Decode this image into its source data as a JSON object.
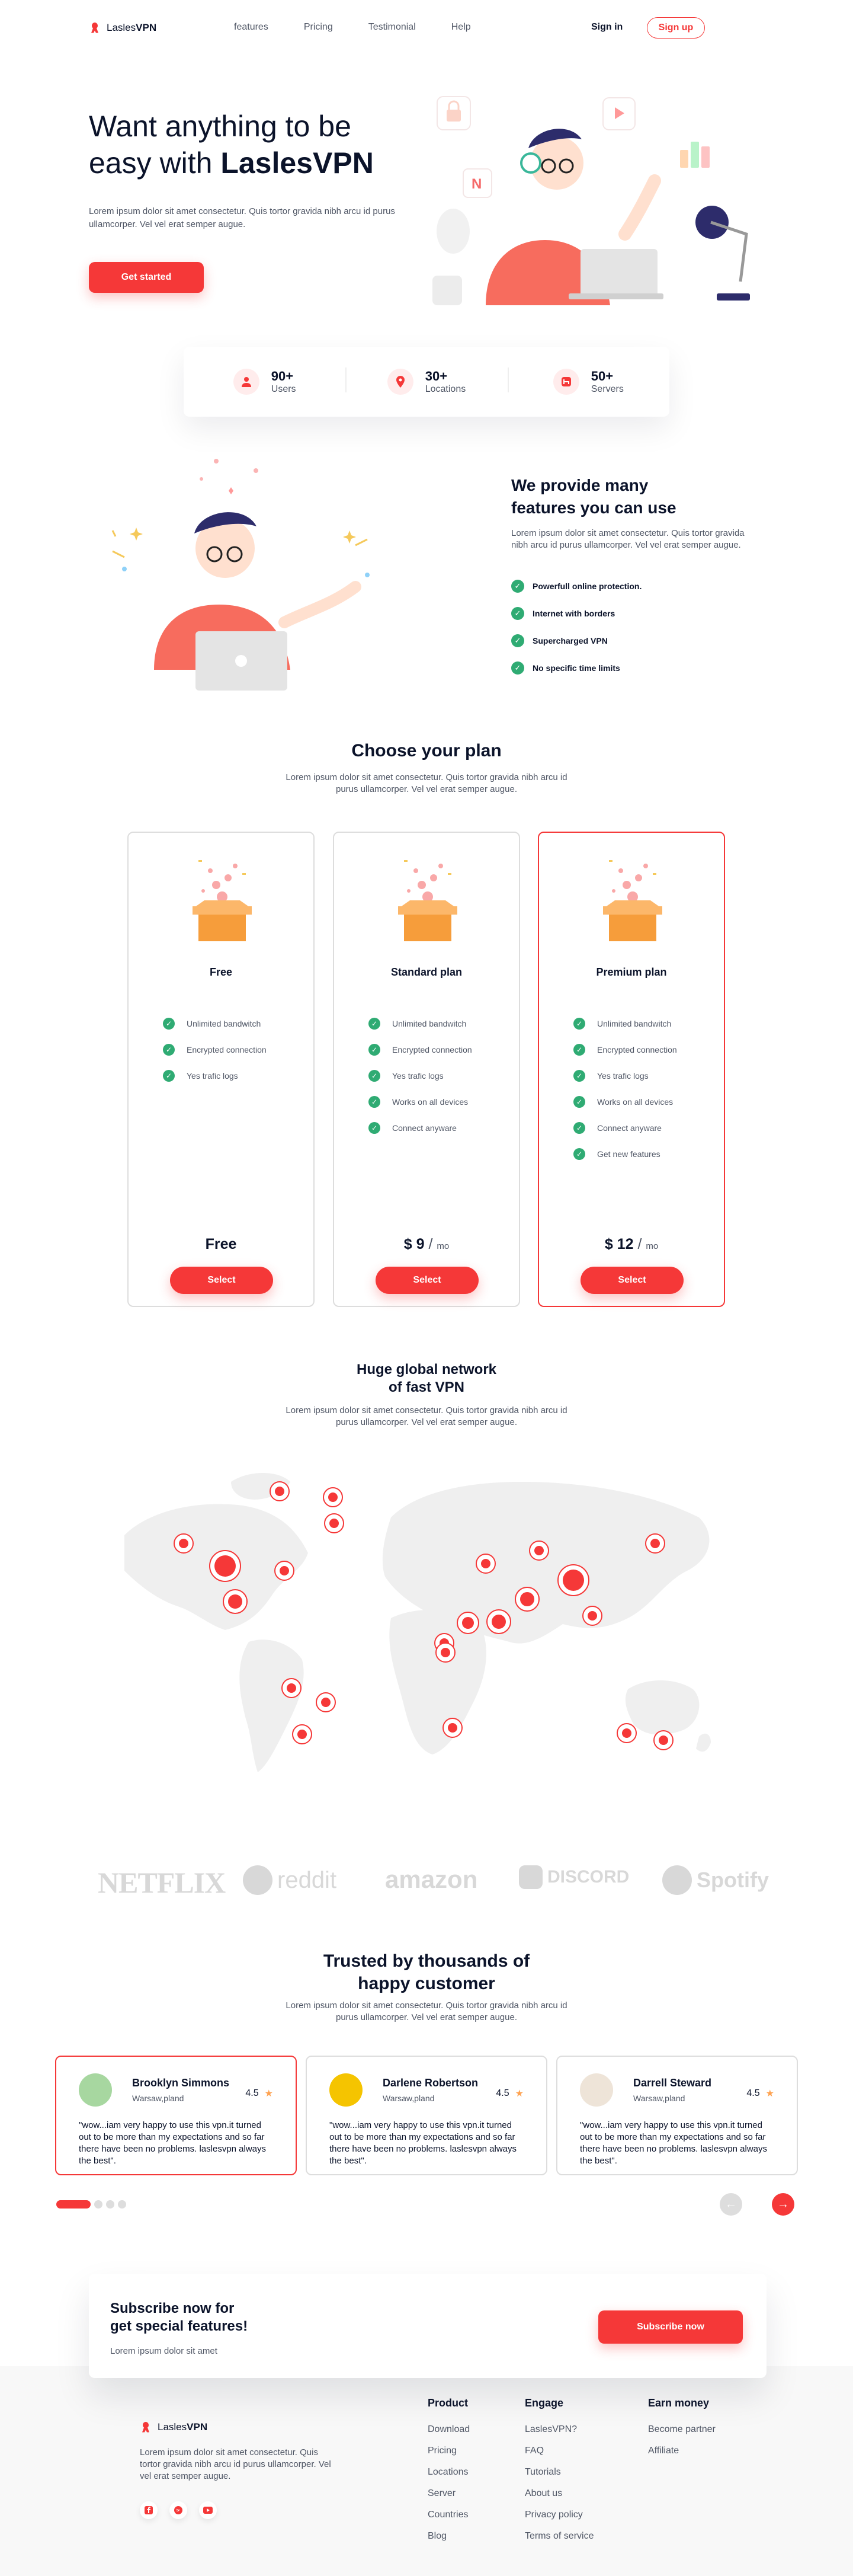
{
  "nav": {
    "brand_light": "Lasles",
    "brand_bold": "VPN",
    "links": [
      "features",
      "Pricing",
      "Testimonial",
      "Help"
    ],
    "signin": "Sign in",
    "signup": "Sign up"
  },
  "hero": {
    "title_line1": "Want anything to be",
    "title_line2_pre": "easy with ",
    "title_line2_bold": "LaslesVPN",
    "text": "Lorem ipsum dolor sit amet consectetur. Quis tortor gravida nibh arcu id purus ullamcorper. Vel vel erat semper augue.",
    "cta": "Get started"
  },
  "stats": [
    {
      "num": "90+",
      "label": "Users",
      "icon": "user-icon"
    },
    {
      "num": "30+",
      "label": "Locations",
      "icon": "location-icon"
    },
    {
      "num": "50+",
      "label": "Servers",
      "icon": "server-icon"
    }
  ],
  "features": {
    "title_line1": "We provide many",
    "title_line2": "features you can use",
    "text": "Lorem ipsum dolor sit amet consectetur. Quis tortor gravida nibh arcu id purus ullamcorper. Vel vel erat semper augue.",
    "items": [
      "Powerfull online protection.",
      "Internet with borders",
      "Supercharged VPN",
      "No specific time limits"
    ]
  },
  "plans": {
    "title": "Choose your plan",
    "text_line1": "Lorem ipsum dolor sit amet consectetur. Quis tortor gravida nibh arcu id",
    "text_line2": "purus ullamcorper. Vel vel erat semper augue.",
    "items": [
      {
        "name": "Free",
        "features": [
          "Unlimited bandwitch",
          "Encrypted connection",
          "Yes trafic logs"
        ],
        "price": "Free",
        "per": "",
        "button": "Select"
      },
      {
        "name": "Standard plan",
        "features": [
          "Unlimited bandwitch",
          "Encrypted connection",
          "Yes trafic logs",
          "Works on all devices",
          "Connect anyware"
        ],
        "price": "$ 9",
        "per": "mo",
        "button": "Select"
      },
      {
        "name": "Premium plan",
        "features": [
          "Unlimited bandwitch",
          "Encrypted connection",
          "Yes trafic logs",
          "Works on all devices",
          "Connect anyware",
          "Get new features"
        ],
        "price": "$ 12",
        "per": "mo",
        "button": "Select"
      }
    ]
  },
  "network": {
    "title_line1": "Huge global network",
    "title_line2": "of fast VPN",
    "text_line1": "Lorem ipsum dolor sit amet consectetur. Quis tortor gravida nibh arcu id",
    "text_line2": "purus ullamcorper. Vel vel erat semper augue."
  },
  "brands": [
    "NETFLIX",
    "reddit",
    "amazon",
    "DISCORD",
    "Spotify"
  ],
  "testimonials": {
    "title_line1": "Trusted by thousands of",
    "title_line2": "happy customer",
    "text_line1": "Lorem ipsum dolor sit amet consectetur. Quis tortor gravida nibh arcu id",
    "text_line2": "purus ullamcorper. Vel vel erat semper augue.",
    "items": [
      {
        "name": "Brooklyn Simmons",
        "location": "Warsaw,pland",
        "rating": "4.5",
        "text": "\"wow...iam very happy to use this vpn.it turned out to be more than my expectations and so far there have been no problems. laslesvpn always the best\"."
      },
      {
        "name": "Darlene Robertson",
        "location": "Warsaw,pland",
        "rating": "4.5",
        "text": "\"wow...iam very happy to use this vpn.it turned out to be more than my expectations and so far there have been no problems. laslesvpn always the best\"."
      },
      {
        "name": "Darrell Steward",
        "location": "Warsaw,pland",
        "rating": "4.5",
        "text": "\"wow...iam very happy to use this vpn.it turned out to be more than my expectations and so far there have been no problems. laslesvpn always the best\"."
      }
    ]
  },
  "subscribe": {
    "title_line1": "Subscribe now for",
    "title_line2": "get special features!",
    "text": "Lorem ipsum dolor sit amet",
    "button": "Subscribe now"
  },
  "footer": {
    "brand_light": "Lasles",
    "brand_bold": "VPN",
    "text": "Lorem ipsum dolor sit amet consectetur. Quis tortor gravida nibh arcu id purus ullamcorper. Vel vel erat semper augue.",
    "columns": [
      {
        "title": "Product",
        "links": [
          "Download",
          "Pricing",
          "Locations",
          "Server",
          "Countries",
          "Blog"
        ]
      },
      {
        "title": "Engage",
        "links": [
          "LaslesVPN?",
          "FAQ",
          "Tutorials",
          "About us",
          "Privacy policy",
          "Terms of service"
        ]
      },
      {
        "title": "Earn money",
        "links": [
          "Become partner",
          "Affiliate"
        ]
      }
    ]
  },
  "colors": {
    "accent": "#F53838",
    "green": "#2FAB73",
    "text": "#0B132A",
    "muted": "#4F5665"
  }
}
